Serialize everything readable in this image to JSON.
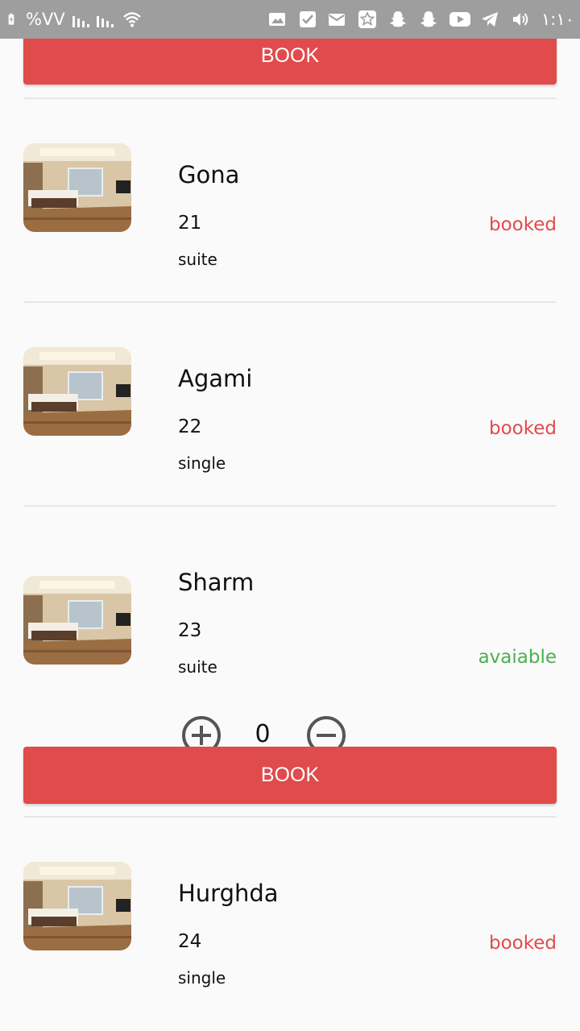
{
  "status_bar": {
    "battery_percent": "%VV",
    "clock": "١:١٠",
    "icons": [
      "battery-charging-icon",
      "signal-icon",
      "signal-icon",
      "wifi-icon",
      "gallery-icon",
      "check-icon",
      "mail-icon",
      "star-icon",
      "snapchat-icon",
      "snapchat-icon",
      "youtube-icon",
      "telegram-icon",
      "volume-icon"
    ]
  },
  "top_book_label": "BOOK",
  "rooms": [
    {
      "name": "Gona",
      "number": "21",
      "type": "suite",
      "status": "booked"
    },
    {
      "name": "Agami",
      "number": "22",
      "type": "single",
      "status": "booked"
    },
    {
      "name": "Sharm",
      "number": "23",
      "type": "suite",
      "status": "avaiable",
      "quantity": "0",
      "book_label": "BOOK"
    },
    {
      "name": "Hurghda",
      "number": "24",
      "type": "single",
      "status": "booked"
    }
  ],
  "colors": {
    "book_button": "#e04b4c",
    "status_booked": "#e04b4c",
    "status_available": "#4caf50",
    "statusbar": "#9e9e9e"
  }
}
